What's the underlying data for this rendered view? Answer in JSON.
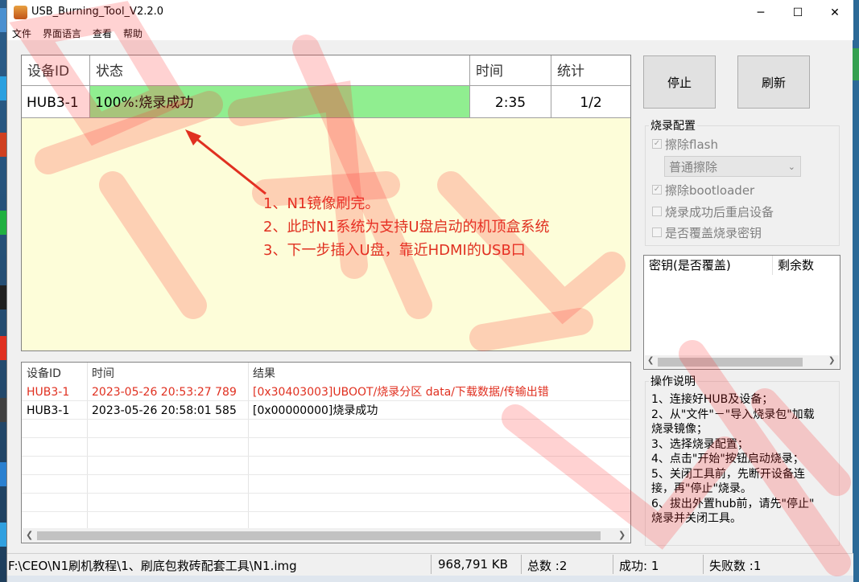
{
  "window": {
    "title": "USB_Burning_Tool_V2.2.0",
    "minimize": "─",
    "maximize": "☐",
    "close": "✕"
  },
  "menu": [
    "文件",
    "界面语言",
    "查看",
    "帮助"
  ],
  "device_table": {
    "headers": [
      "设备ID",
      "状态",
      "时间",
      "统计"
    ],
    "rows": [
      {
        "id": "HUB3-1",
        "status": "100%:烧录成功",
        "time": "2:35",
        "count": "1/2",
        "status_color": "#90ee90"
      }
    ]
  },
  "annotation": {
    "lines": [
      "1、N1镜像刷完。",
      "2、此时N1系统为支持U盘启动的机顶盒系统",
      "3、下一步插入U盘，靠近HDMI的USB口"
    ],
    "color": "#e03020"
  },
  "log_table": {
    "headers": [
      "设备ID",
      "时间",
      "结果"
    ],
    "rows": [
      {
        "id": "HUB3-1",
        "time": "2023-05-26 20:53:27 789",
        "result": "[0x30403003]UBOOT/烧录分区 data/下载数据/传输出错",
        "error": true
      },
      {
        "id": "HUB3-1",
        "time": "2023-05-26 20:58:01 585",
        "result": "[0x00000000]烧录成功",
        "error": false
      }
    ]
  },
  "buttons": {
    "stop": "停止",
    "refresh": "刷新"
  },
  "burn_config": {
    "title": "烧录配置",
    "erase_flash": "擦除flash",
    "erase_mode": "普通擦除",
    "erase_bootloader": "擦除bootloader",
    "reboot_after": "烧录成功后重启设备",
    "overwrite_key": "是否覆盖烧录密钥"
  },
  "key_table": {
    "headers": [
      "密钥(是否覆盖)",
      "剩余数"
    ]
  },
  "instructions": {
    "title": "操作说明",
    "lines": [
      "1、连接好HUB及设备；",
      "2、从\"文件\"－\"导入烧录包\"加载",
      "烧录镜像；",
      "3、选择烧录配置；",
      "4、点击\"开始\"按钮启动烧录；",
      "5、关闭工具前，先断开设备连",
      "接，再\"停止\"烧录。",
      "6、拔出外置hub前，请先\"停止\"",
      "烧录并关闭工具。"
    ]
  },
  "status_bar": {
    "path": "F:\\CEO\\N1刷机教程\\1、刷底包救砖配套工具\\N1.img",
    "size": "968,791 KB",
    "total": "总数 :2",
    "success": "成功:  1",
    "fail": "失败数 :1"
  }
}
